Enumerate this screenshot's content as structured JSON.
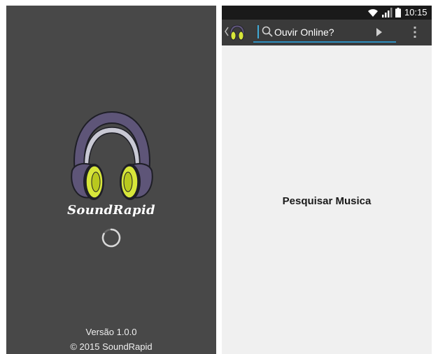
{
  "splash": {
    "app_name": "SoundRapid",
    "version": "Versão 1.0.0",
    "copyright": "© 2015 SoundRapid",
    "logo_icon": "headphones-icon",
    "loading_icon": "spinner-icon"
  },
  "status_bar": {
    "time": "10:15",
    "icons": [
      "wifi-icon",
      "signal-icon",
      "battery-icon"
    ]
  },
  "action_bar": {
    "up_icon": "chevron-left-icon",
    "app_icon": "headphones-icon",
    "search": {
      "value": "",
      "placeholder": "Ouvir Online?",
      "icon": "search-icon",
      "submit_icon": "play-arrow-icon"
    },
    "overflow_icon": "more-vert-icon"
  },
  "content": {
    "heading": "Pesquisar Musica"
  },
  "colors": {
    "splash_bg": "#484848",
    "content_bg": "#f0f0f0",
    "action_bar_bg": "#3a3a3a",
    "status_bar_bg": "#1a1a1a",
    "accent": "#33b5e5",
    "headphone_band": "#5e5578",
    "headphone_cup": "#d7e63a"
  }
}
